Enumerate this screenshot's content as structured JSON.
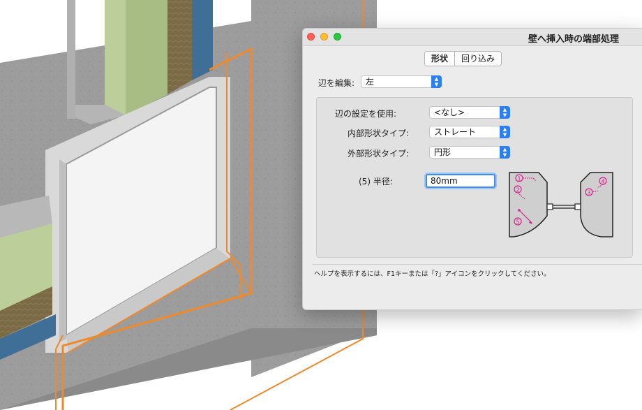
{
  "window": {
    "title": "壁へ挿入時の端部処理"
  },
  "tabs": [
    {
      "label": "形状",
      "active": true
    },
    {
      "label": "回り込み",
      "active": false
    }
  ],
  "edit_edge": {
    "label": "辺を編集:",
    "value": "左"
  },
  "settings": {
    "use_edge_settings": {
      "label": "辺の設定を使用:",
      "value": "<なし>"
    },
    "inner_shape_type": {
      "label": "内部形状タイプ:",
      "value": "ストレート"
    },
    "outer_shape_type": {
      "label": "外部形状タイプ:",
      "value": "円形"
    },
    "radius": {
      "label": "(5) 半径:",
      "value": "80mm"
    }
  },
  "diagram": {
    "callouts": [
      "1",
      "2",
      "3",
      "4",
      "5"
    ]
  },
  "help_text": "ヘルプを表示するには、F1キーまたは「?」アイコンをクリックしてください。",
  "colors": {
    "accent": "#2c7ff0",
    "highlight_orange": "#f0892a",
    "callout_magenta": "#d6208c",
    "dialog_bg": "#ececec"
  }
}
